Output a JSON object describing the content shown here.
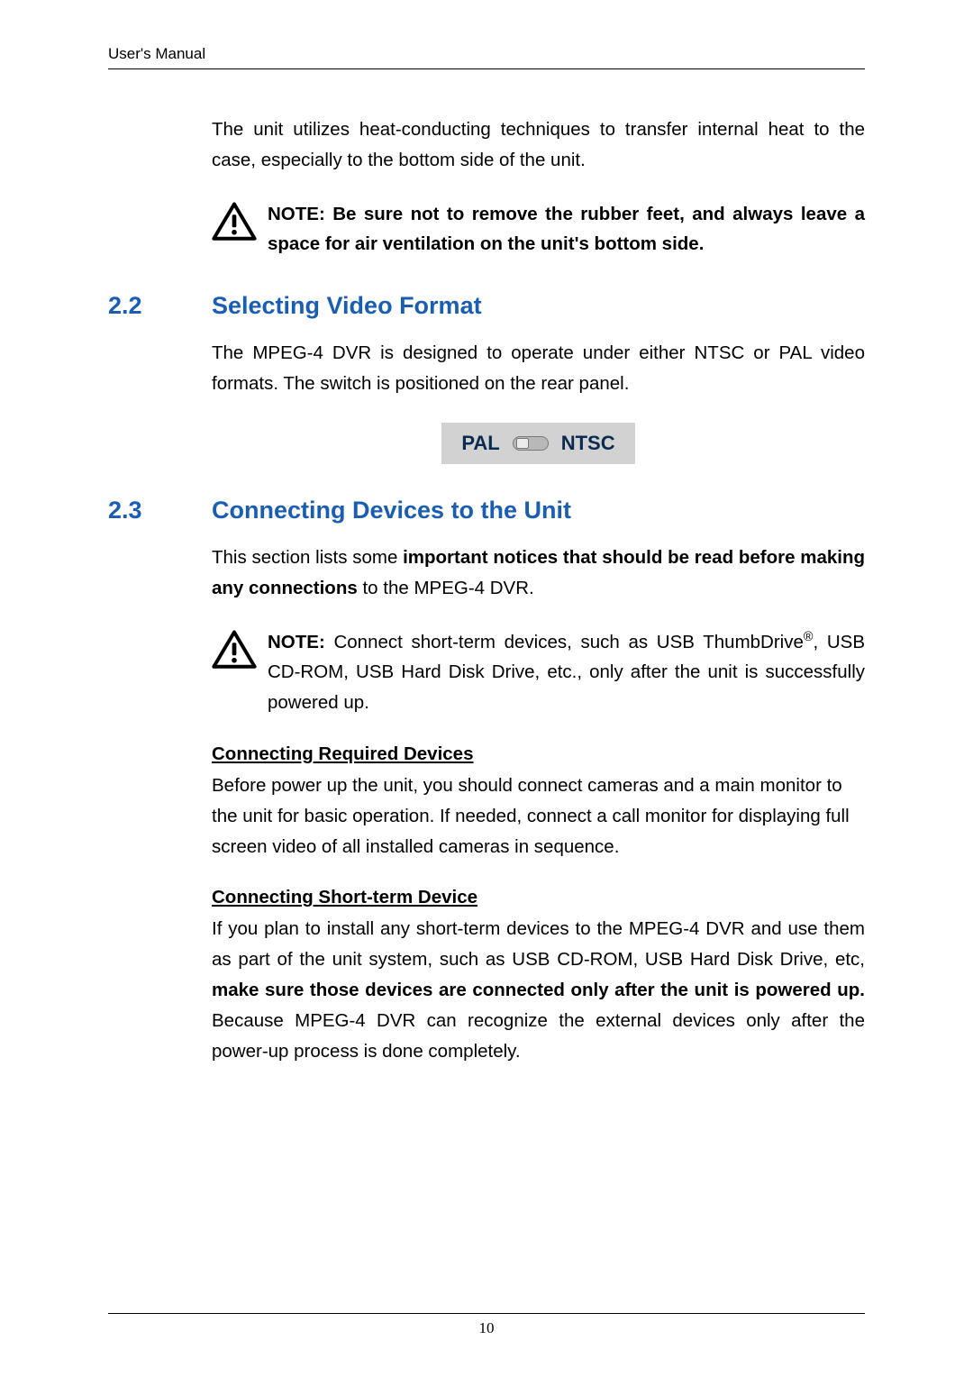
{
  "header": {
    "title": "User's Manual"
  },
  "intro": {
    "para1": "The unit utilizes heat-conducting techniques to transfer internal heat to the case, especially to the bottom side of the unit."
  },
  "note1": {
    "label": "NOTE:",
    "text": " Be sure not to remove the rubber feet, and always leave a space for air ventilation on the unit's bottom side."
  },
  "section22": {
    "num": "2.2",
    "title": "Selecting Video Format",
    "para": "The MPEG-4 DVR is designed to operate under either NTSC or PAL video formats. The switch is positioned on the rear panel.",
    "switch": {
      "left": "PAL",
      "right": "NTSC"
    }
  },
  "section23": {
    "num": "2.3",
    "title": "Connecting Devices to the Unit",
    "intro_plain1": "This section lists some ",
    "intro_bold": "important notices that should be read before making any connections",
    "intro_plain2": " to the MPEG-4 DVR.",
    "note": {
      "label": "NOTE:",
      "t1": " Connect short-term devices, such as USB ThumbDrive",
      "sup": "®",
      "t2": ", USB CD-ROM, USB Hard Disk Drive, etc., only after the unit is successfully powered up."
    },
    "sub1": {
      "heading": "Connecting Required Devices",
      "para": "Before power up the unit, you should connect cameras and a main monitor to the unit for basic operation. If needed, connect a call monitor for displaying full screen video of all installed cameras in sequence."
    },
    "sub2": {
      "heading": "Connecting Short-term Device",
      "p1": "If you plan to install any short-term devices to the MPEG-4 DVR and use them as part of the unit system, such as USB CD-ROM, USB Hard Disk Drive, etc, ",
      "bold": "make sure those devices are connected only after the unit is powered up.",
      "p2": " Because MPEG-4 DVR can recognize the external devices only after the power-up process is done completely."
    }
  },
  "footer": {
    "page_number": "10"
  }
}
